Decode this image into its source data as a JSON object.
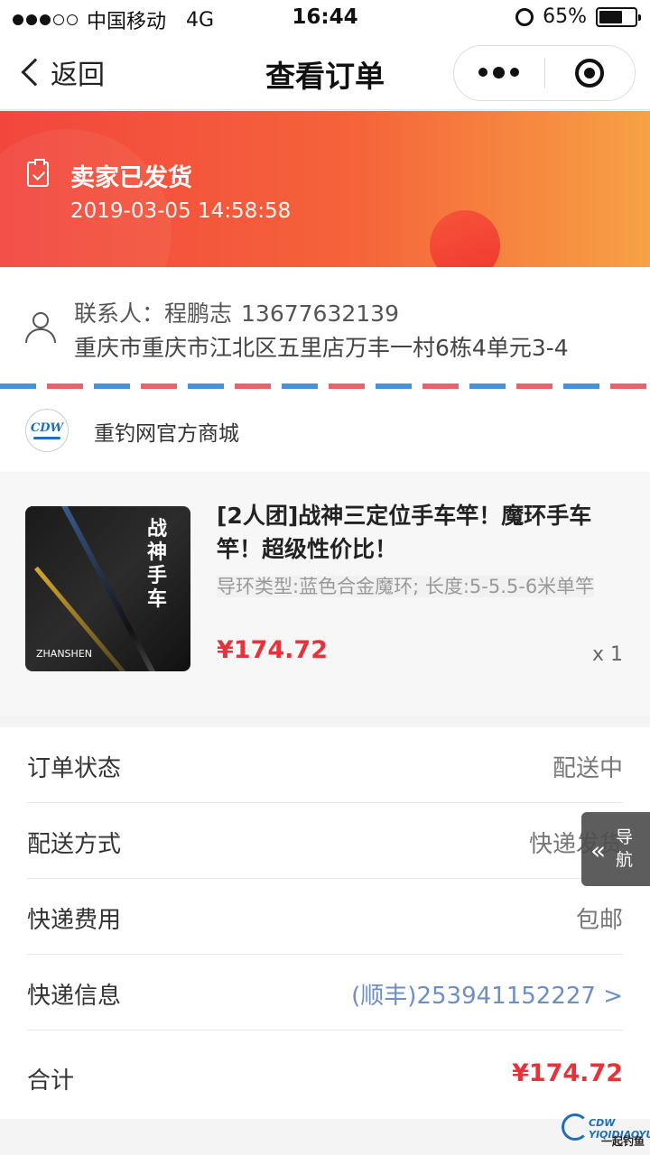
{
  "status_bar": {
    "carrier": "中国移动",
    "network": "4G",
    "time": "16:44",
    "battery_text": "65%",
    "battery_level": 0.65
  },
  "nav": {
    "back_label": "返回",
    "title": "查看订单"
  },
  "order_status": {
    "title": "卖家已发货",
    "time": "2019-03-05 14:58:58"
  },
  "address": {
    "contact_label": "联系人：",
    "contact_name": "程鹏志",
    "phone": "13677632139",
    "full_address": "重庆市重庆市江北区五里店万丰一村6栋4单元3-4"
  },
  "shop": {
    "name": "重钓网官方商城",
    "logo_text": "CDW"
  },
  "product": {
    "title": "[2人团]战神三定位手车竿！魔环手车竿！超级性价比！",
    "spec": "导环类型:蓝色合金魔环; 长度:5-5.5-6米单竿",
    "price": "¥174.72",
    "quantity": "x 1",
    "image_title": "战神手车",
    "image_brand": "ZHANSHEN"
  },
  "info": {
    "rows": [
      {
        "label": "订单状态",
        "value": "配送中"
      },
      {
        "label": "配送方式",
        "value": "快递发货"
      },
      {
        "label": "快递费用",
        "value": "包邮"
      },
      {
        "label": "快递信息",
        "value": "(顺丰)253941152227 >"
      }
    ],
    "total_label": "合计",
    "total_value": "¥174.72"
  },
  "float_nav": {
    "arrows": "«",
    "label": "导航"
  },
  "watermark": {
    "line1": "CDW YIQIDIAOYU",
    "line2": "一起钓鱼"
  },
  "colors": {
    "accent_red": "#e8323a",
    "link_blue": "#6b8fc6",
    "hero_start": "#f2463d",
    "hero_end": "#f7a244"
  }
}
